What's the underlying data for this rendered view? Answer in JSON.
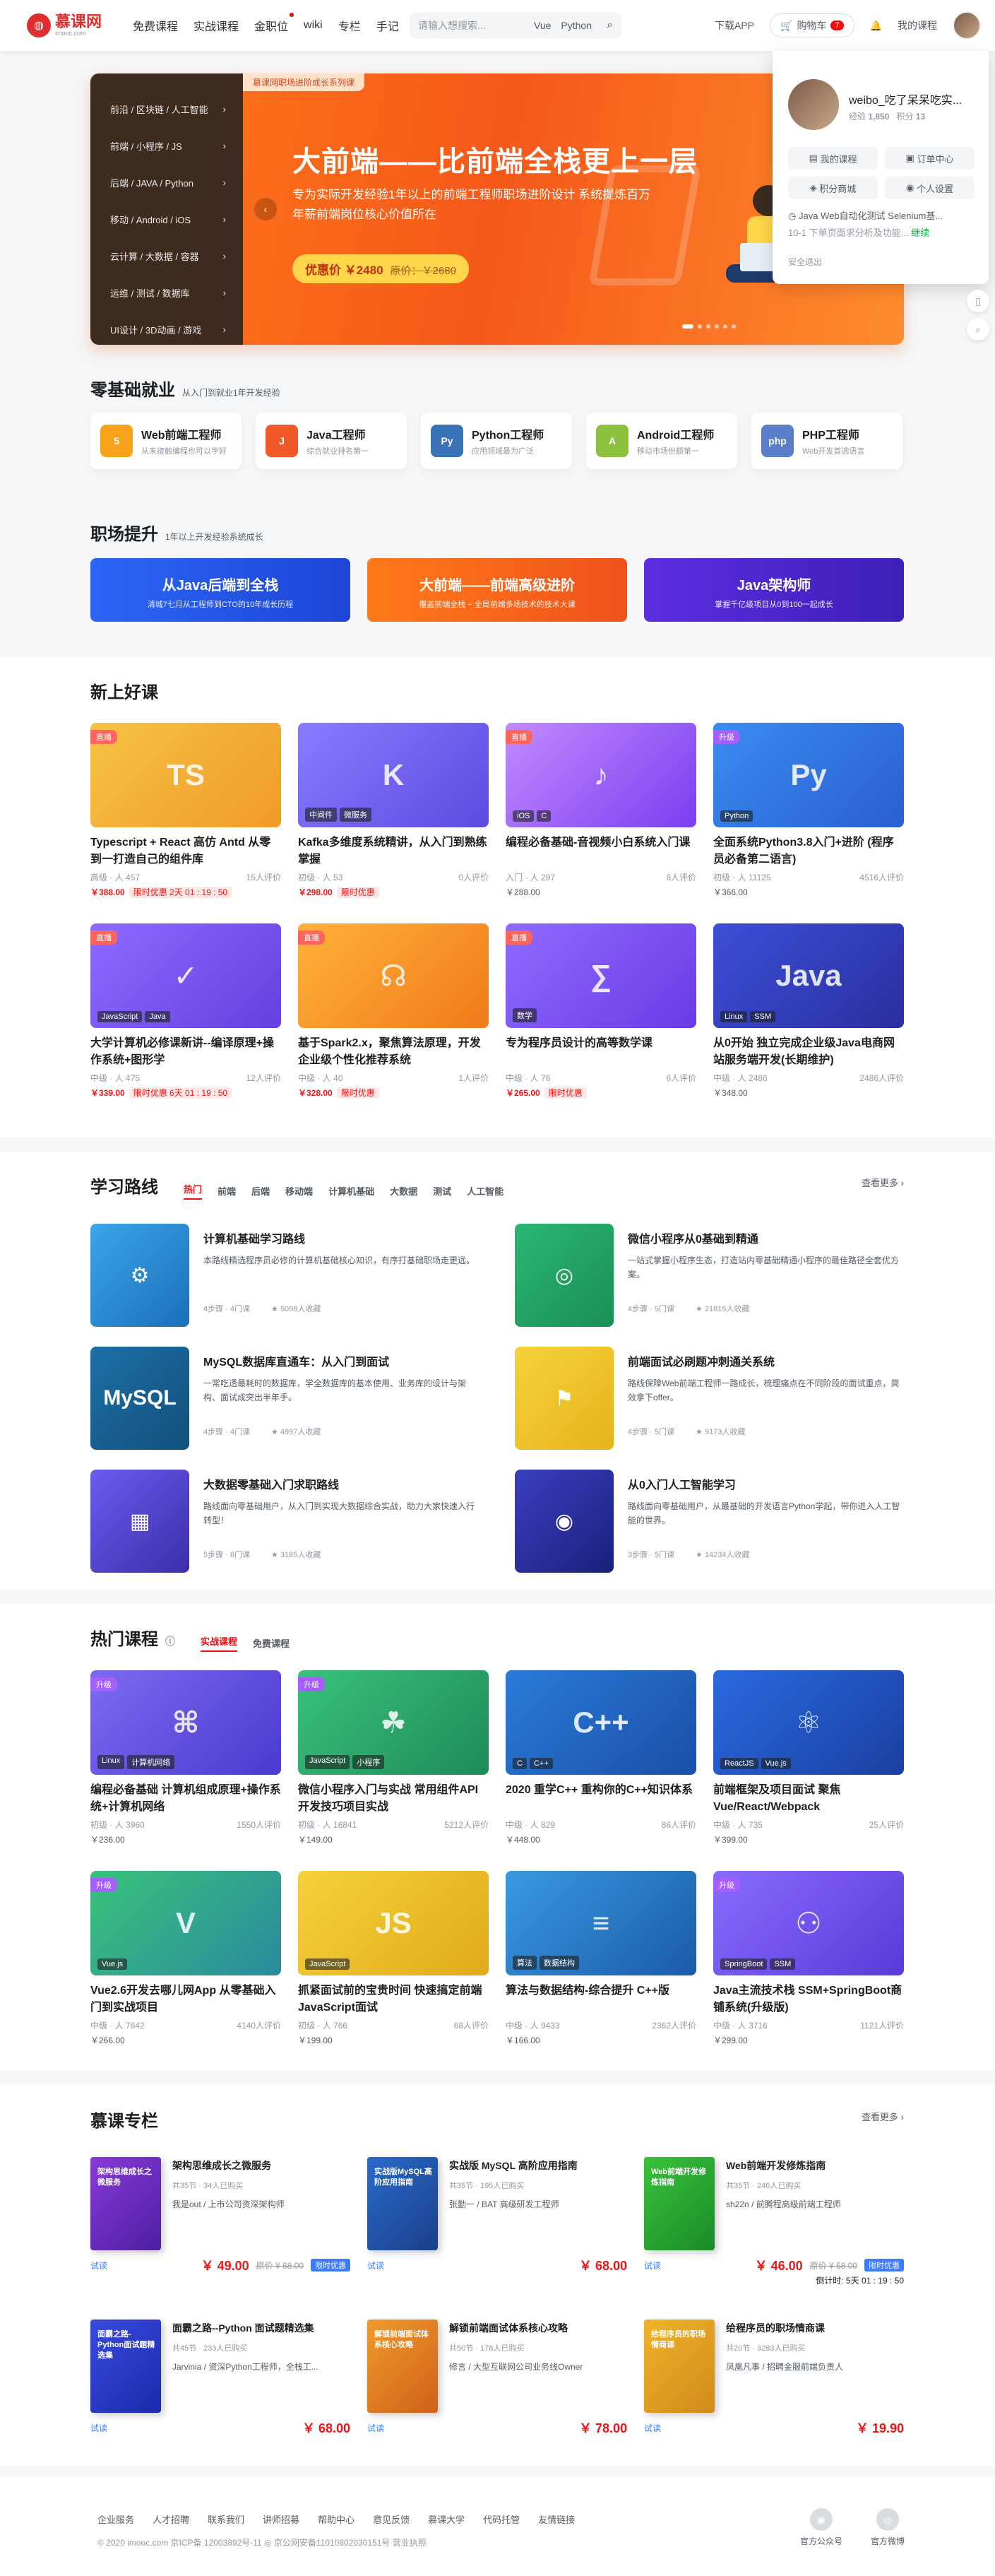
{
  "header": {
    "logo": "慕课网",
    "logo_sub": "imooc.com",
    "nav": [
      "免费课程",
      "实战课程",
      "金职位",
      "wiki",
      "专栏",
      "手记"
    ],
    "search_placeholder": "请输入想搜索...",
    "search_keywords": [
      "Vue",
      "Python"
    ],
    "download": "下载APP",
    "cart": "购物车",
    "cart_count": "7",
    "my_course": "我的课程"
  },
  "banner": {
    "tag": "慕课网职场进阶成长系列课",
    "title": "大前端——比前端全栈更上一层",
    "subtitle": "专为实际开发经验1年以上的前端工程师职场进阶设计 系统提炼百万年薪前端岗位核心价值所在",
    "price_label": "优惠价 ￥2480",
    "orig_price": "原价：￥2680",
    "menu": [
      "前沿 / 区块链 / 人工智能",
      "前端 / 小程序 / JS",
      "后端 / JAVA / Python",
      "移动 / Android / iOS",
      "云计算 / 大数据 / 容器",
      "运维 / 测试 / 数据库",
      "UI设计 / 3D动画 / 游戏"
    ]
  },
  "user_panel": {
    "name": "weibo_吃了呆呆吃实...",
    "exp_label": "经验",
    "exp": "1,850",
    "points_label": "积分",
    "points": "13",
    "links": [
      "我的课程",
      "订单中心",
      "积分商城",
      "个人设置"
    ],
    "recent": "Java Web自动化测试 Selenium基...",
    "recent_progress": "10-1 下单页面求分析及功能...",
    "continue": "继续",
    "logout": "安全退出"
  },
  "zero": {
    "title": "零基础就业",
    "sub": "从入门到就业1年开发经验",
    "paths": [
      {
        "name": "Web前端工程师",
        "desc": "从来接触编程也可以学好",
        "icon": "5",
        "color": "#f7a21a"
      },
      {
        "name": "Java工程师",
        "desc": "综合就业排名第一",
        "icon": "J",
        "color": "#f05a28"
      },
      {
        "name": "Python工程师",
        "desc": "应用领域最为广泛",
        "icon": "Py",
        "color": "#3a73b5"
      },
      {
        "name": "Android工程师",
        "desc": "移动市场份额第一",
        "icon": "A",
        "color": "#8cc23f"
      },
      {
        "name": "PHP工程师",
        "desc": "Web开发首选语言",
        "icon": "php",
        "color": "#5a7fc8"
      }
    ]
  },
  "career": {
    "title": "职场提升",
    "sub": "1年以上开发经验系统成长",
    "cards": [
      {
        "title": "从Java后端到全栈",
        "desc": "清城7七月从工程师到CTO的10年成长历程",
        "color": "linear-gradient(90deg,#2b66f6,#1e45d6)"
      },
      {
        "title": "大前端——前端高级进阶",
        "desc": "覆盖前端全栈 + 全局前端多场技术的技术大课",
        "color": "linear-gradient(90deg,#ff7a1a,#f0521a)"
      },
      {
        "title": "Java架构师",
        "desc": "掌握千亿级项目从0到100一起成长",
        "color": "linear-gradient(90deg,#5b2ee0,#3d1fb8)"
      }
    ]
  },
  "new_courses": {
    "title": "新上好课",
    "items": [
      {
        "title": "Typescript + React 高仿 Antd 从零到一打造自己的组件库",
        "level": "高级",
        "students": "457",
        "reviews": "15人评价",
        "price": "￥388.00",
        "sale": "限时优惠 2天 01 : 19 : 50",
        "tag": "直播",
        "labels": [],
        "bg": "linear-gradient(135deg,#f6c344,#f09a2a)",
        "art": "TS"
      },
      {
        "title": "Kafka多维度系统精讲，从入门到熟练掌握",
        "level": "初级",
        "students": "53",
        "reviews": "0人评价",
        "price": "￥298.00",
        "sale": "限时优惠",
        "tag": "",
        "labels": [
          "中间件",
          "微服务"
        ],
        "bg": "linear-gradient(135deg,#8a7cff,#5b4be0)",
        "art": "K"
      },
      {
        "title": "编程必备基础-音视频小白系统入门课",
        "level": "入门",
        "students": "297",
        "reviews": "8人评价",
        "price": "￥288.00",
        "sale": "",
        "tag": "直播",
        "labels": [
          "iOS",
          "C"
        ],
        "bg": "linear-gradient(135deg,#c28bff,#7a3ef0)",
        "art": "♪"
      },
      {
        "title": "全面系统Python3.8入门+进阶 (程序员必备第二语言)",
        "level": "初级",
        "students": "11125",
        "reviews": "4516人评价",
        "price": "￥366.00",
        "sale": "",
        "tag": "升级",
        "labels": [
          "Python"
        ],
        "bg": "linear-gradient(135deg,#3a8cf0,#2a5fd0)",
        "art": "Py"
      },
      {
        "title": "大学计算机必修课新讲--编译原理+操作系统+图形学",
        "level": "中级",
        "students": "475",
        "reviews": "12人评价",
        "price": "￥339.00",
        "sale": "限时优惠 6天 01 : 19 : 50",
        "tag": "直播",
        "labels": [
          "JavaScript",
          "Java"
        ],
        "bg": "linear-gradient(135deg,#8d6bff,#6440e0)",
        "art": "✓"
      },
      {
        "title": "基于Spark2.x，聚焦算法原理，开发企业级个性化推荐系统",
        "level": "中级",
        "students": "40",
        "reviews": "1人评价",
        "price": "￥328.00",
        "sale": "限时优惠",
        "tag": "直播",
        "labels": [],
        "bg": "linear-gradient(135deg,#ffb23a,#f07a1a)",
        "art": "☊"
      },
      {
        "title": "专为程序员设计的高等数学课",
        "level": "中级",
        "students": "76",
        "reviews": "6人评价",
        "price": "￥265.00",
        "sale": "限时优惠",
        "tag": "直播",
        "labels": [
          "数学"
        ],
        "bg": "linear-gradient(135deg,#8f6bff,#6a3be6)",
        "art": "∑"
      },
      {
        "title": "从0开始 独立完成企业级Java电商网站服务端开发(长期维护)",
        "level": "中级",
        "students": "2486",
        "reviews": "2486人评价",
        "price": "￥348.00",
        "sale": "",
        "tag": "",
        "labels": [
          "Linux",
          "SSM"
        ],
        "bg": "linear-gradient(135deg,#3d4fd8,#2a2f9e)",
        "art": "Java"
      }
    ]
  },
  "routes": {
    "title": "学习路线",
    "tabs": [
      "热门",
      "前端",
      "后端",
      "移动端",
      "计算机基础",
      "大数据",
      "测试",
      "人工智能"
    ],
    "more": "查看更多",
    "items": [
      {
        "title": "计算机基础学习路线",
        "desc": "本路线精选程序员必修的计算机基础核心知识，有序打基础职场走更远。",
        "meta1": "4步骤 · 4门课",
        "meta2": "5098人收藏",
        "bg": "linear-gradient(135deg,#3aa6e8,#1c6fb8)",
        "art": "⚙"
      },
      {
        "title": "微信小程序从0基础到精通",
        "desc": "一站式掌握小程序生态，打造站内零基础精通小程序的最佳路径全套优方案。",
        "meta1": "4步骤 · 5门课",
        "meta2": "21815人收藏",
        "bg": "linear-gradient(135deg,#2bb673,#1a8f55)",
        "art": "◎"
      },
      {
        "title": "MySQL数据库直通车：从入门到面试",
        "desc": "一常吃透最耗时的数据库，学全数据库的基本使用、业务库的设计与架构、面试成突出半年手。",
        "meta1": "4步骤 · 4门课",
        "meta2": "4997人收藏",
        "bg": "linear-gradient(135deg,#1d6fa8,#12507a)",
        "art": "MySQL"
      },
      {
        "title": "前端面试必刷题冲刺通关系统",
        "desc": "路线保障Web前端工程师一路成长，梳理痛点在不同阶段的面试重点，简效拿下offer。",
        "meta1": "4步骤 · 5门课",
        "meta2": "9173人收藏",
        "bg": "linear-gradient(135deg,#f5d23a,#e6b41a)",
        "art": "⚑"
      },
      {
        "title": "大数据零基础入门求职路线",
        "desc": "路线面向零基础用户，从入门到实现大数据综合实战，助力大家快速入行转型！",
        "meta1": "5步骤 · 8门课",
        "meta2": "3185人收藏",
        "bg": "linear-gradient(135deg,#6a5cf0,#3a2fa8)",
        "art": "▦"
      },
      {
        "title": "从0入门人工智能学习",
        "desc": "路线面向零基础用户，从最基础的开发语言Python学起，带你进入人工智能的世界。",
        "meta1": "3步骤 · 5门课",
        "meta2": "14234人收藏",
        "bg": "linear-gradient(135deg,#3a3fc0,#1a1f7a)",
        "art": "◉"
      }
    ]
  },
  "hot": {
    "title": "热门课程",
    "tabs": [
      "实战课程",
      "免费课程"
    ],
    "items": [
      {
        "title": "编程必备基础 计算机组成原理+操作系统+计算机网络",
        "level": "初级",
        "students": "3960",
        "reviews": "1550人评价",
        "price": "￥236.00",
        "tag": "升级",
        "labels": [
          "Linux",
          "计算机网络"
        ],
        "bg": "linear-gradient(135deg,#7c6bf0,#4a3ad0)",
        "art": "⌘"
      },
      {
        "title": "微信小程序入门与实战 常用组件API开发技巧项目实战",
        "level": "初级",
        "students": "16841",
        "reviews": "5212人评价",
        "price": "￥149.00",
        "tag": "升级",
        "labels": [
          "JavaScript",
          "小程序"
        ],
        "bg": "linear-gradient(135deg,#3ac27a,#1e8a5a)",
        "art": "☘"
      },
      {
        "title": "2020 重学C++ 重构你的C++知识体系",
        "level": "中级",
        "students": "829",
        "reviews": "86人评价",
        "price": "￥448.00",
        "tag": "",
        "labels": [
          "C",
          "C++"
        ],
        "bg": "linear-gradient(135deg,#2a7bd8,#1a4fa8)",
        "art": "C++"
      },
      {
        "title": "前端框架及项目面试 聚焦Vue/React/Webpack",
        "level": "中级",
        "students": "735",
        "reviews": "25人评价",
        "price": "￥399.00",
        "tag": "",
        "labels": [
          "ReactJS",
          "Vue.js"
        ],
        "bg": "linear-gradient(135deg,#2a6ae0,#1a3fa0)",
        "art": "⚛"
      },
      {
        "title": "Vue2.6开发去哪儿网App 从零基础入门到实战项目",
        "level": "中级",
        "students": "7642",
        "reviews": "4140人评价",
        "price": "￥266.00",
        "tag": "升级",
        "labels": [
          "Vue.js"
        ],
        "bg": "linear-gradient(135deg,#3ac27a,#2a8a9e)",
        "art": "V"
      },
      {
        "title": "抓紧面试前的宝贵时间 快速搞定前端JavaScript面试",
        "level": "初级",
        "students": "766",
        "reviews": "68人评价",
        "price": "￥199.00",
        "tag": "",
        "labels": [
          "JavaScript"
        ],
        "bg": "linear-gradient(135deg,#f5d23a,#e0aa1a)",
        "art": "JS"
      },
      {
        "title": "算法与数据结构-综合提升 C++版",
        "level": "中级",
        "students": "9433",
        "reviews": "2362人评价",
        "price": "￥166.00",
        "tag": "",
        "labels": [
          "算法",
          "数据结构"
        ],
        "bg": "linear-gradient(135deg,#3a9ae0,#1a5aa8)",
        "art": "≡"
      },
      {
        "title": "Java主流技术栈 SSM+SpringBoot商铺系统(升级版)",
        "level": "中级",
        "students": "3716",
        "reviews": "1121人评价",
        "price": "￥299.00",
        "tag": "升级",
        "labels": [
          "SpringBoot",
          "SSM"
        ],
        "bg": "linear-gradient(135deg,#8a6bff,#5a3ad8)",
        "art": "⚇"
      }
    ]
  },
  "columns": {
    "title": "慕课专栏",
    "more": "查看更多",
    "items": [
      {
        "title": "架构思维成长之微服务",
        "book": "架构思维成长之微服务",
        "meta": "共35节 · 34人已购买",
        "author": "我是out / 上市公司资深架构师",
        "price": "￥ 49.00",
        "orig": "原价 ¥ 68.00",
        "badge": "限时优惠",
        "countdown": "",
        "bg": "linear-gradient(135deg,#8a3ad8,#4a1fa0)"
      },
      {
        "title": "实战版 MySQL 高阶应用指南",
        "book": "实战版MySQL高阶应用指南",
        "meta": "共35节 · 195人已购买",
        "author": "张勤一 / BAT 高级研发工程师",
        "price": "￥ 68.00",
        "orig": "",
        "badge": "",
        "countdown": "",
        "bg": "linear-gradient(135deg,#2a6ac8,#1a3f8a)"
      },
      {
        "title": "Web前端开发修炼指南",
        "book": "Web前端开发修炼指南",
        "meta": "共35节 · 246人已购买",
        "author": "sh22n / 前腾程高级前端工程师",
        "price": "￥ 46.00",
        "orig": "原价 ¥ 58.00",
        "badge": "限时优惠",
        "countdown": "倒计时: 5天 01 : 19 : 50",
        "bg": "linear-gradient(135deg,#3ac23a,#1a8a2a)"
      },
      {
        "title": "面霸之路--Python 面试题精选集",
        "book": "面霸之路-Python面试题精选集",
        "meta": "共45节 · 233人已购买",
        "author": "Jarvinia / 资深Python工程师，全栈工...",
        "price": "￥ 68.00",
        "orig": "",
        "badge": "",
        "countdown": "",
        "bg": "linear-gradient(135deg,#3a4ae0,#1a2aa8)"
      },
      {
        "title": "解锁前端面试体系核心攻略",
        "book": "解锁前端面试体系核心攻略",
        "meta": "共50节 · 178人已购买",
        "author": "修言 / 大型互联网公司业务线Owner",
        "price": "￥ 78.00",
        "orig": "",
        "badge": "",
        "countdown": "",
        "bg": "linear-gradient(135deg,#f09a2a,#d0601a)"
      },
      {
        "title": "给程序员的职场情商课",
        "book": "给程序员的职场情商课",
        "meta": "共20节 · 3283人已购买",
        "author": "凤凰凡事 / 招聘金服前端负责人",
        "price": "￥ 19.90",
        "orig": "",
        "badge": "",
        "countdown": "",
        "bg": "linear-gradient(135deg,#f0b42a,#d08a1a)"
      }
    ]
  },
  "footer": {
    "links": [
      "企业服务",
      "人才招聘",
      "联系我们",
      "讲师招募",
      "帮助中心",
      "意见反馈",
      "慕课大学",
      "代码托管",
      "友情链接"
    ],
    "copyright": "© 2020 imooc.com  京ICP备 12003892号-11  ◎ 京公网安备11010802030151号  营业执照",
    "qr": [
      "官方公众号",
      "官方微博"
    ]
  }
}
